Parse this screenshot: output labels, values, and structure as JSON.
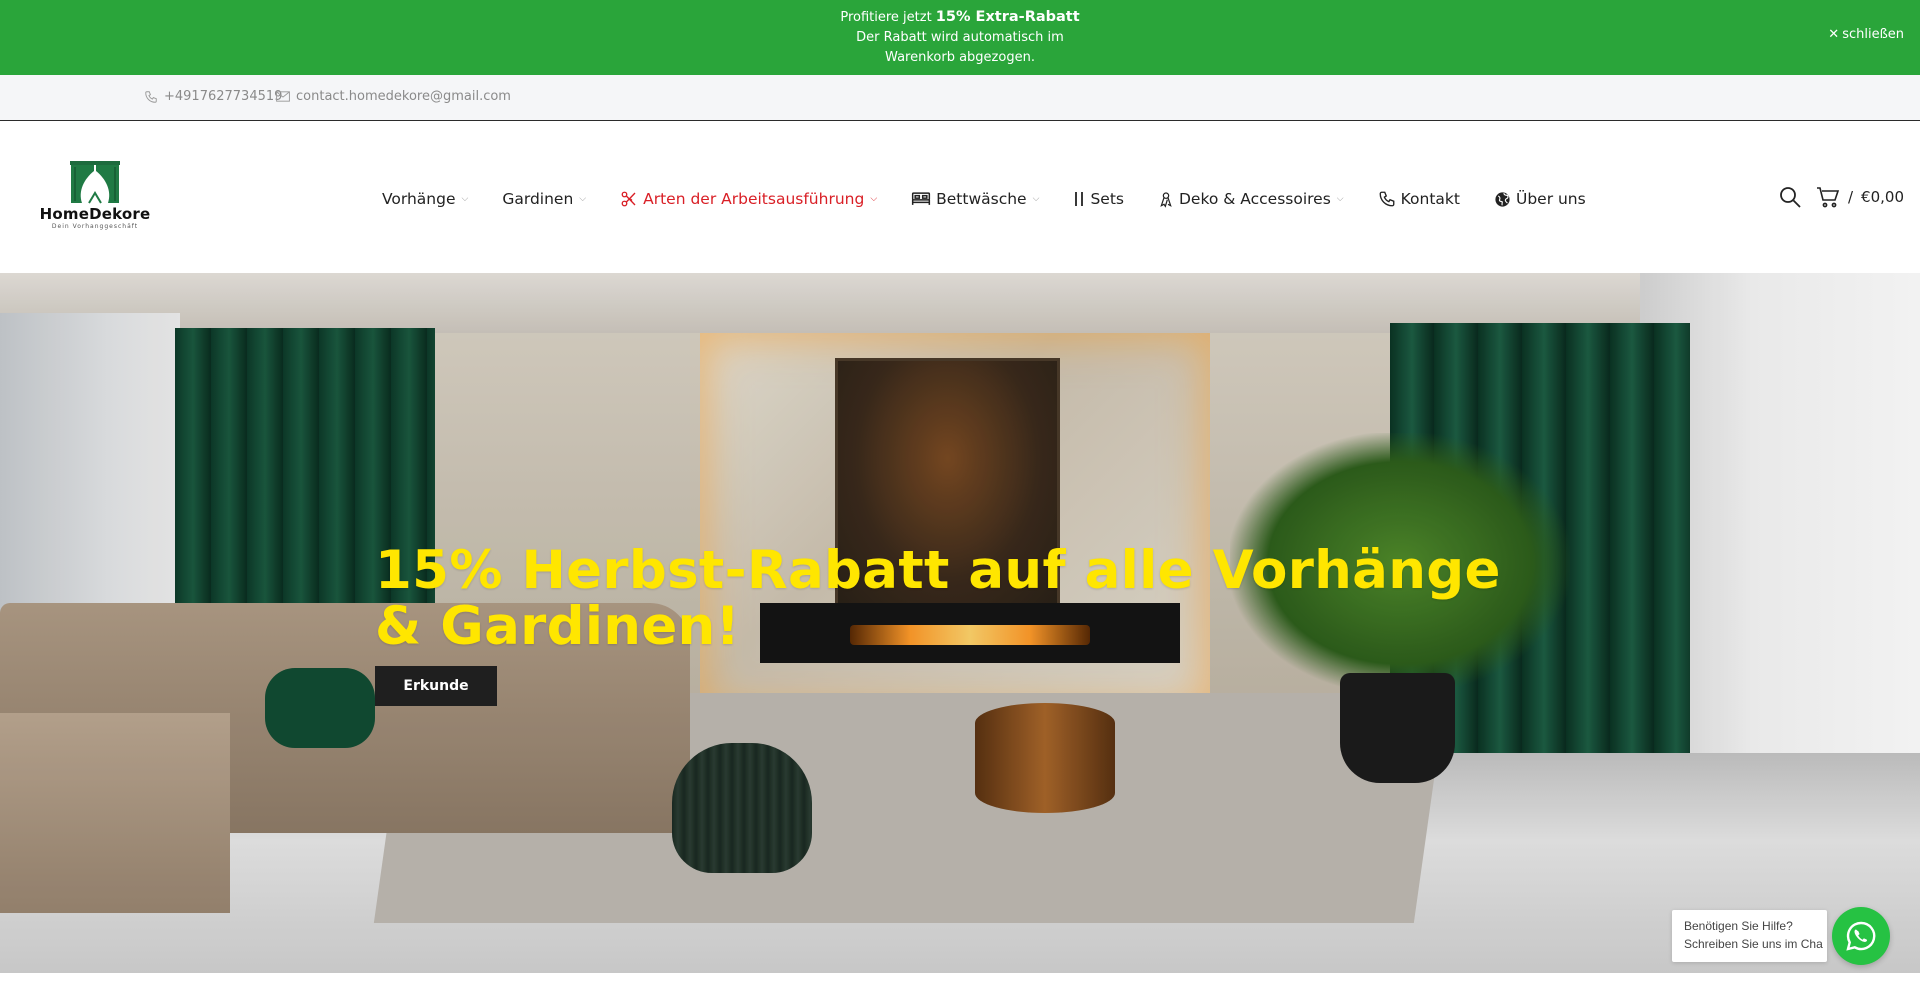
{
  "promo": {
    "line1_prefix": "Profitiere jetzt ",
    "line1_bold": "15% Extra-Rabatt",
    "line2": "Der Rabatt wird automatisch im Warenkorb abgezogen.",
    "close_label": "schließen"
  },
  "contact": {
    "phone": "+4917627734519",
    "email": "contact.homedekore@gmail.com"
  },
  "logo": {
    "name": "HomeDekore",
    "tagline": "Dein Vorhanggeschäft"
  },
  "nav": {
    "items": [
      {
        "label": "Vorhänge",
        "icon": "none",
        "has_dropdown": true
      },
      {
        "label": "Gardinen",
        "icon": "none",
        "has_dropdown": true
      },
      {
        "label": "Arten der Arbeitsausführung",
        "icon": "scissors-icon",
        "has_dropdown": true,
        "active": true
      },
      {
        "label": "Bettwäsche",
        "icon": "bed-icon",
        "has_dropdown": true
      },
      {
        "label": "Sets",
        "icon": "sets-icon",
        "has_dropdown": false
      },
      {
        "label": "Deko & Accessoires",
        "icon": "ribbon-icon",
        "has_dropdown": true
      },
      {
        "label": "Kontakt",
        "icon": "phone-icon",
        "has_dropdown": false
      },
      {
        "label": "Über uns",
        "icon": "globe-icon",
        "has_dropdown": false
      }
    ],
    "active_color": "#d91f26"
  },
  "cart": {
    "separator": "/",
    "total": "€0,00"
  },
  "hero": {
    "title": "15% Herbst-Rabatt auf alle Vorhänge & Gardinen!",
    "button_label": "Erkunde",
    "title_color": "#ffe600"
  },
  "whatsapp": {
    "line1": "Benötigen Sie Hilfe?",
    "line2": "Schreiben Sie uns im Cha"
  },
  "colors": {
    "promo_bg": "#2aa53a",
    "whatsapp": "#26c243"
  }
}
